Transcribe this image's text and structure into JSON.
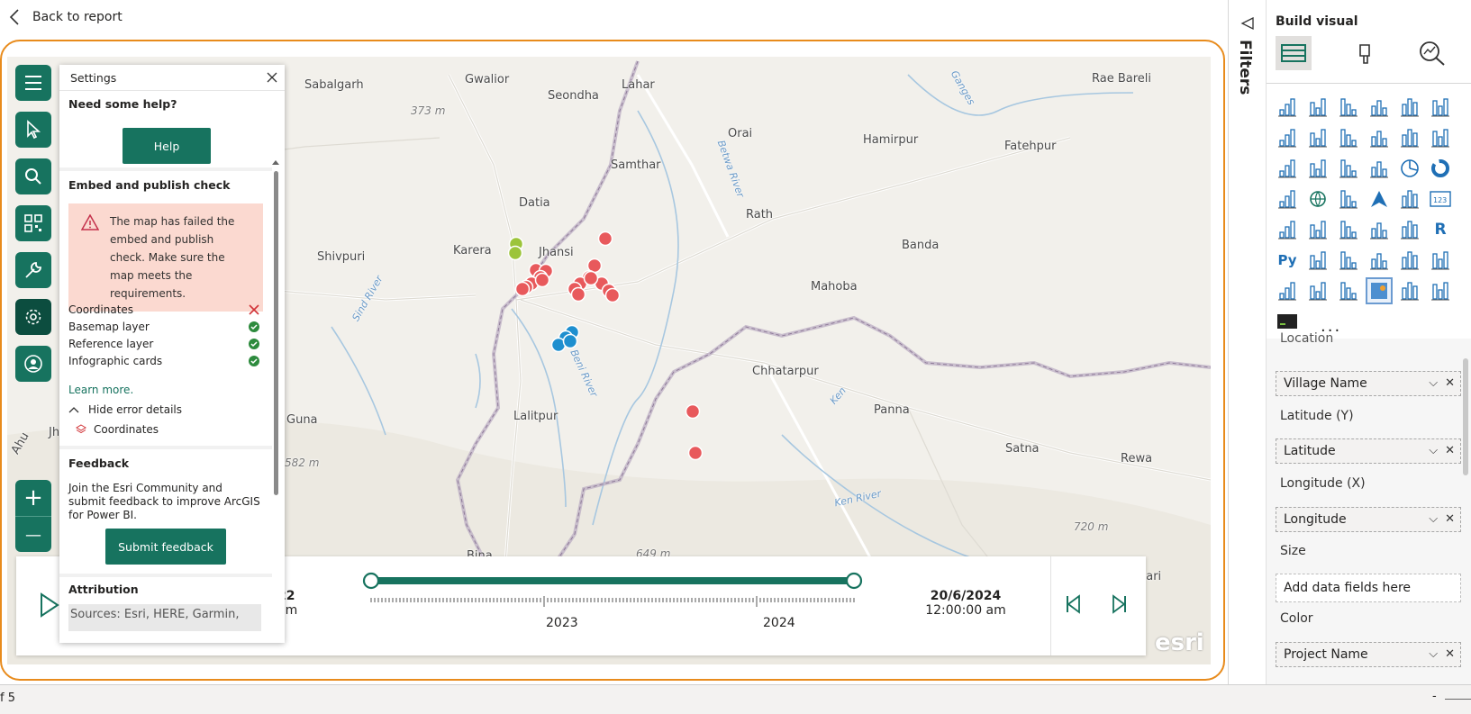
{
  "nav": {
    "back_label": "Back to report"
  },
  "map": {
    "labels": {
      "sabalgarh": "Sabalgarh",
      "gwalior": "Gwalior",
      "seondha": "Seondha",
      "lahar": "Lahar",
      "rae_bareli": "Rae Bareli",
      "elev_373": "373 m",
      "orai": "Orai",
      "hamirpur": "Hamirpur",
      "fatehpur": "Fatehpur",
      "samthar": "Samthar",
      "datia": "Datia",
      "rath": "Rath",
      "karera": "Karera",
      "jhansi": "Jhansi",
      "banda": "Banda",
      "shivpuri": "Shivpuri",
      "mahoba": "Mahoba",
      "sind_river": "Sind River",
      "betwa_river": "Betwa River",
      "ganges": "Ganges",
      "chhatarpur": "Chhatarpur",
      "lalitpur": "Lalitpur",
      "ken": "Ken",
      "panna": "Panna",
      "guna": "Guna",
      "satna": "Satna",
      "rewa": "Rewa",
      "elev_582": "582 m",
      "ken_river": "Ken River",
      "elev_720": "720 m",
      "elev_649": "649 m",
      "bina": "Bina",
      "mari": "hari",
      "jh": "Jh",
      "ahu": "Ahu",
      "beni_river": "Beni River"
    },
    "marker_colors": {
      "red": "#e8595c",
      "blue": "#1e8fcf",
      "green": "#9cc43a"
    },
    "attribution_logo": "esri"
  },
  "toolbar": {
    "items": [
      {
        "icon": "menu-icon"
      },
      {
        "icon": "select-icon"
      },
      {
        "icon": "search-icon"
      },
      {
        "icon": "qr-grid-icon"
      },
      {
        "icon": "wrench-icon"
      },
      {
        "icon": "gear-icon"
      },
      {
        "icon": "user-icon"
      }
    ],
    "zoom_in": "+",
    "zoom_out": "—"
  },
  "settings": {
    "title": "Settings",
    "help_heading": "Need some help?",
    "help_button": "Help",
    "embed_heading": "Embed and publish check",
    "error_message": "The map has failed the embed and publish check. Make sure the map meets the requirements.",
    "checks": [
      {
        "label": "Coordinates",
        "status": "fail"
      },
      {
        "label": "Basemap layer",
        "status": "pass"
      },
      {
        "label": "Reference layer",
        "status": "pass"
      },
      {
        "label": "Infographic cards",
        "status": "pass"
      }
    ],
    "learn_more": "Learn more.",
    "hide_details": "Hide error details",
    "error_item": "Coordinates",
    "feedback_heading": "Feedback",
    "feedback_text": "Join the Esri Community and submit feedback to improve ArcGIS for Power BI.",
    "feedback_button": "Submit feedback",
    "attribution_heading": "Attribution",
    "attribution_text": "Sources: Esri, HERE, Garmin,"
  },
  "timeline": {
    "start_date_partial": "22",
    "start_time_partial": "am",
    "end_date": "20/6/2024",
    "end_time": "12:00:00 am",
    "year_labels": [
      "2023",
      "2024"
    ],
    "range_fraction": [
      0.0,
      1.0
    ]
  },
  "filters_pane": {
    "label": "Filters"
  },
  "build_visual": {
    "title": "Build visual",
    "wells": [
      {
        "section": "Location",
        "value": "Village Name"
      },
      {
        "section": "Latitude (Y)",
        "value": "Latitude"
      },
      {
        "section": "Longitude (X)",
        "value": "Longitude"
      },
      {
        "section": "Size",
        "placeholder": "Add data fields here"
      },
      {
        "section": "Color",
        "value": "Project Name"
      }
    ],
    "more": "..."
  },
  "status_bar": {
    "page_text": "f 5",
    "zoom_minus": "-"
  },
  "colors": {
    "accent": "#17735f",
    "frame": "#e88b1c",
    "error_bg": "#fbd9d0"
  }
}
